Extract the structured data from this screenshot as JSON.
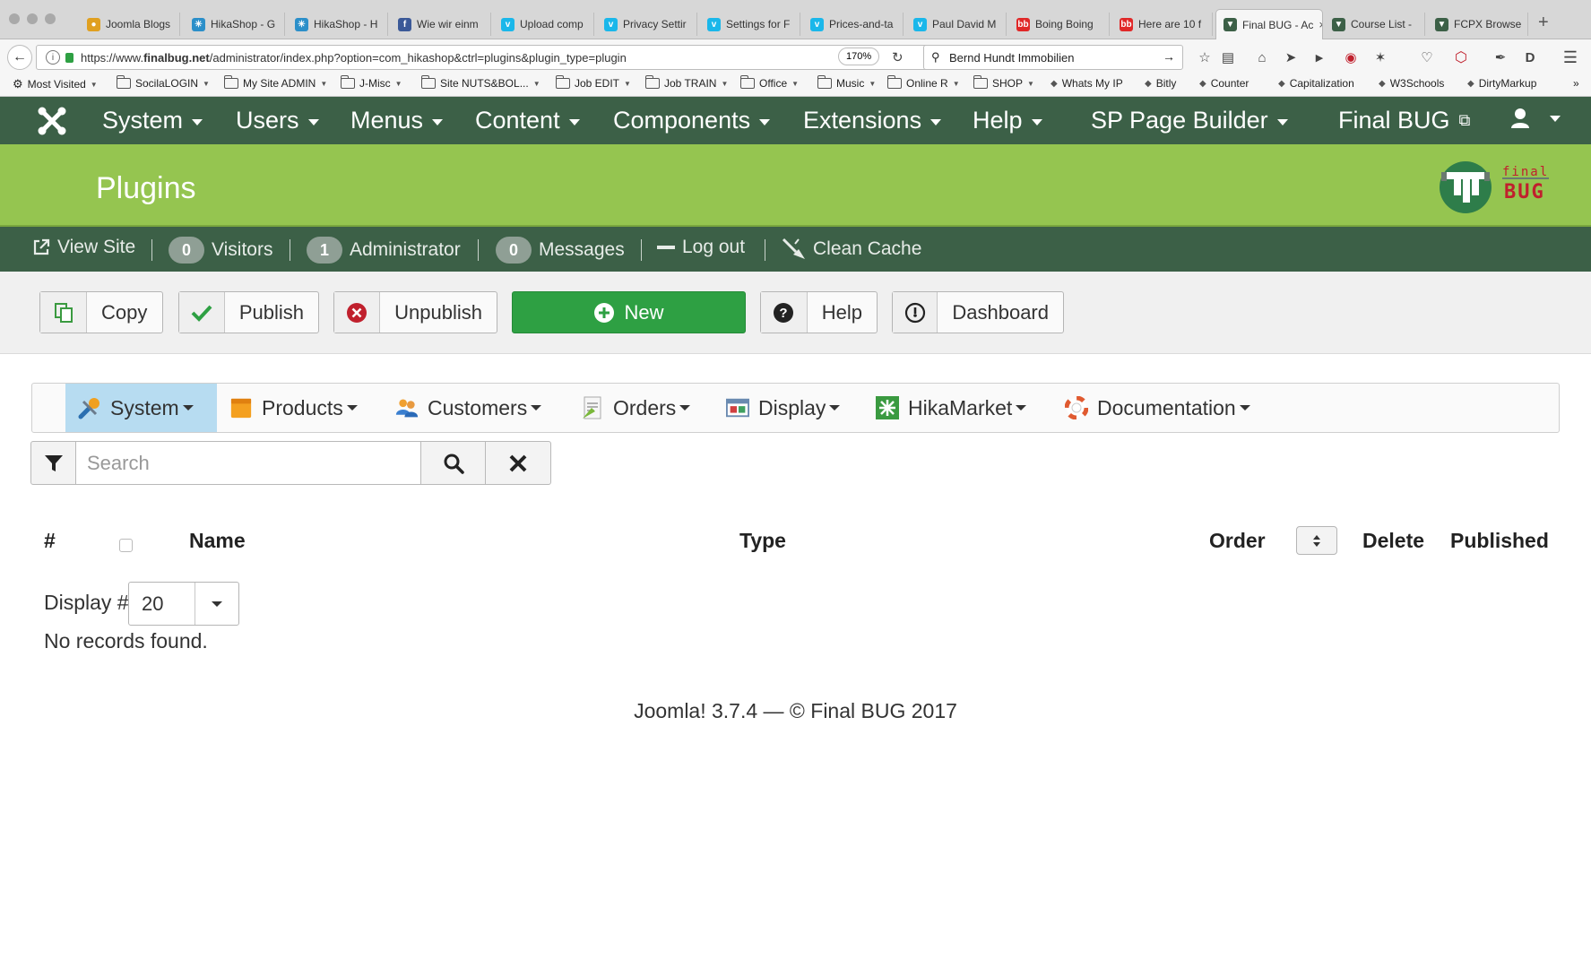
{
  "browser": {
    "tabs": [
      {
        "title": "Joomla Blogs",
        "icon": "joomla-blogs-icon",
        "color": "#e0a020"
      },
      {
        "title": "HikaShop - G",
        "icon": "hikashop-icon",
        "color": "#2b8fc9"
      },
      {
        "title": "HikaShop - H",
        "icon": "hikashop-icon",
        "color": "#2b8fc9"
      },
      {
        "title": "Wie wir einm",
        "icon": "facebook-icon",
        "color": "#3b5998"
      },
      {
        "title": "Upload comp",
        "icon": "vimeo-icon",
        "color": "#1ab7ea"
      },
      {
        "title": "Privacy Settir",
        "icon": "vimeo-icon",
        "color": "#1ab7ea"
      },
      {
        "title": "Settings for F",
        "icon": "vimeo-icon",
        "color": "#1ab7ea"
      },
      {
        "title": "Prices-and-ta",
        "icon": "vimeo-icon",
        "color": "#1ab7ea"
      },
      {
        "title": "Paul David M",
        "icon": "vimeo-icon",
        "color": "#1ab7ea"
      },
      {
        "title": "Boing Boing",
        "icon": "boingboing-icon",
        "color": "#e02828"
      },
      {
        "title": "Here are 10 f",
        "icon": "boingboing-icon",
        "color": "#e02828"
      },
      {
        "title": "Final BUG - Ac",
        "icon": "finalbug-icon",
        "color": "#3c6047",
        "active": true
      },
      {
        "title": "Course List -",
        "icon": "finalbug-icon",
        "color": "#3c6047"
      },
      {
        "title": "FCPX Browse",
        "icon": "finalbug-icon",
        "color": "#3c6047"
      }
    ],
    "url_prefix": "https://www.",
    "url_domain": "finalbug.net",
    "url_path": "/administrator/index.php?option=com_hikashop&ctrl=plugins&plugin_type=plugin",
    "zoom": "170%",
    "search_value": "Bernd Hundt Immobilien",
    "bookmarks": [
      {
        "label": "Most Visited",
        "type": "gear"
      },
      {
        "label": "SocilaLOGIN",
        "type": "folder"
      },
      {
        "label": "My Site ADMIN",
        "type": "folder"
      },
      {
        "label": "J-Misc",
        "type": "folder"
      },
      {
        "label": "Site NUTS&BOL...",
        "type": "folder"
      },
      {
        "label": "Job EDIT",
        "type": "folder"
      },
      {
        "label": "Job TRAIN",
        "type": "folder"
      },
      {
        "label": "Office",
        "type": "folder"
      },
      {
        "label": "Music",
        "type": "folder"
      },
      {
        "label": "Online R",
        "type": "folder"
      },
      {
        "label": "SHOP",
        "type": "folder"
      },
      {
        "label": "Whats My IP",
        "type": "link"
      },
      {
        "label": "Bitly",
        "type": "link"
      },
      {
        "label": "Counter",
        "type": "link"
      },
      {
        "label": "Capitalization",
        "type": "link"
      },
      {
        "label": "W3Schools",
        "type": "link"
      },
      {
        "label": "DirtyMarkup",
        "type": "link"
      }
    ]
  },
  "topnav": {
    "items": [
      "System",
      "Users",
      "Menus",
      "Content",
      "Components",
      "Extensions",
      "Help",
      "SP Page Builder",
      "Final BUG"
    ]
  },
  "header": {
    "title": "Plugins",
    "logo_line1": "final",
    "logo_line2": "BUG"
  },
  "status": {
    "view_site": "View Site",
    "visitors_count": "0",
    "visitors_label": "Visitors",
    "admin_count": "1",
    "admin_label": "Administrator",
    "messages_count": "0",
    "messages_label": "Messages",
    "logout": "Log out",
    "clean_cache": "Clean Cache"
  },
  "toolbar": {
    "copy": "Copy",
    "publish": "Publish",
    "unpublish": "Unpublish",
    "new": "New",
    "help": "Help",
    "dashboard": "Dashboard"
  },
  "hikamenu": {
    "items": [
      "System",
      "Products",
      "Customers",
      "Orders",
      "Display",
      "HikaMarket",
      "Documentation"
    ]
  },
  "filter": {
    "placeholder": "Search"
  },
  "table": {
    "col_num": "#",
    "col_name": "Name",
    "col_type": "Type",
    "col_order": "Order",
    "col_delete": "Delete",
    "col_published": "Published"
  },
  "list": {
    "display_label": "Display #",
    "display_value": "20",
    "empty": "No records found."
  },
  "footer": {
    "text": "Joomla! 3.7.4  —  © Final BUG 2017"
  },
  "colors": {
    "nav_dark": "#3c6047",
    "header_green": "#95c550",
    "new_button": "#2ea043",
    "active_menu": "#b7dcf1"
  }
}
